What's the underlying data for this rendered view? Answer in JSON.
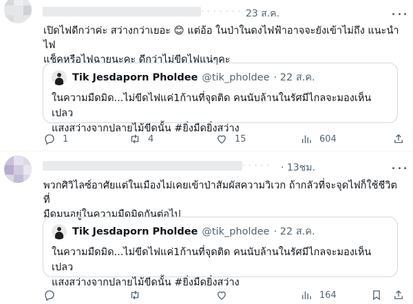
{
  "replies": [
    {
      "time": "23 ส.ค.",
      "text": "เปิดไฟดีกว่าค่ะ สว่างกว่าเยอะ 😊 แต่อ้อ ในป่าในดงไฟฟ้าอาจจะยังเข้าไม่ถึง แนะนำไฟ\nแช็คหรือไฟฉายนะคะ ดีกว่าไม่ขีดไฟแน่ๆคะ",
      "quote": {
        "name": "Tik Jesdaporn Pholdee",
        "handle": "@tik_pholdee",
        "date": "· 22 ส.ค.",
        "text": "ในความมืดมิด...ไม่ขีดไฟแค่1ก้านที่จุดติด คนนับล้านในรัศมีไกลจะมองเห็นเปลว\nแสงสว่างจากปลายไม้ขีดนั้น #ยิ่งมืดยิ่งสว่าง"
      },
      "actions": {
        "replies": "1",
        "reposts": "4",
        "likes": "15",
        "views": "604"
      }
    },
    {
      "time": "· 13ชม.",
      "text": "พวกศิวิไลซ์อาศัยแต่ในเมืองไม่เคยเข้าป่าสัมผัสความวิเวก ถ้ากลัวที่จะจุดไฟก็ใช้ชีวิตที่\nมืดมนอยู่ในความมืดมิดกันต่อไป",
      "quote": {
        "name": "Tik Jesdaporn Pholdee",
        "handle": "@tik_pholdee",
        "date": "· 22 ส.ค.",
        "text": "ในความมืดมิด...ไม่ขีดไฟแค่1ก้านที่จุดติด คนนับล้านในรัศมีไกลจะมองเห็นเปลว\nแสงสว่างจากปลายไม้ขีดนั้น #ยิ่งมืดยิ่งสว่าง"
      },
      "actions": {
        "replies": "",
        "reposts": "",
        "likes": "",
        "views": "164"
      }
    }
  ],
  "colors": {
    "text": "#0f1419",
    "muted": "#536471",
    "border": "#cfd9de"
  },
  "icons": [
    "more-icon",
    "reply-icon",
    "repost-icon",
    "like-icon",
    "views-icon",
    "bookmark-icon",
    "share-icon"
  ]
}
